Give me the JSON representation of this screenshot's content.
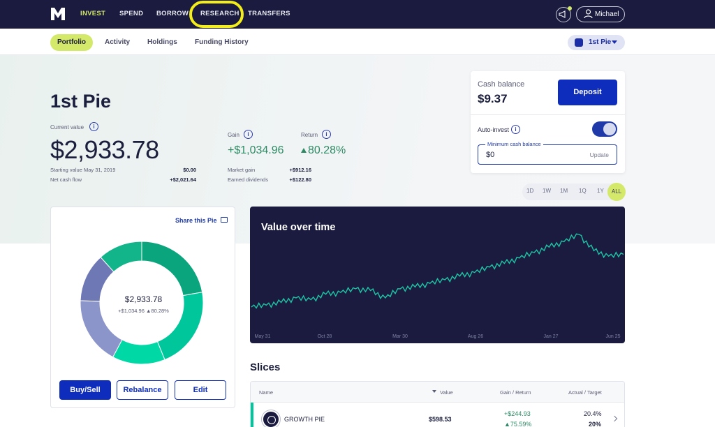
{
  "nav": {
    "logo": "M",
    "items": [
      {
        "label": "INVEST",
        "active": true
      },
      {
        "label": "SPEND"
      },
      {
        "label": "BORROW"
      },
      {
        "label": "RESEARCH",
        "highlighted": true
      },
      {
        "label": "TRANSFERS"
      }
    ],
    "user": "Michael"
  },
  "subnav": {
    "tabs": [
      "Portfolio",
      "Activity",
      "Holdings",
      "Funding History"
    ],
    "pie_selector": "1st Pie"
  },
  "pie": {
    "name": "1st Pie",
    "current_value_label": "Current value",
    "current_value": "$2,933.78",
    "starting_value_label": "Starting value May 31, 2019",
    "starting_value": "$0.00",
    "net_cash_flow_label": "Net cash flow",
    "net_cash_flow": "+$2,021.64",
    "gain_label": "Gain",
    "gain": "+$1,034.96",
    "return_label": "Return",
    "return": "80.28%",
    "market_gain_label": "Market gain",
    "market_gain": "+$912.16",
    "earned_dividends_label": "Earned dividends",
    "earned_dividends": "+$122.80"
  },
  "cash": {
    "label": "Cash balance",
    "value": "$9.37",
    "deposit": "Deposit",
    "auto_invest_label": "Auto-invest",
    "auto_invest_on": true,
    "min_label": "Minimum cash balance",
    "min_value": "$0",
    "update": "Update"
  },
  "ranges": [
    "1D",
    "1W",
    "1M",
    "1Q",
    "1Y",
    "ALL"
  ],
  "pie_card": {
    "share": "Share this Pie",
    "center_value": "$2,933.78",
    "center_sub": "+$1,034.96 ▲80.28%",
    "buttons": [
      "Buy/Sell",
      "Rebalance",
      "Edit"
    ],
    "segment_colors": [
      "#0aa57d",
      "#00c79b",
      "#00d9a5",
      "#8c95c9",
      "#6e78b5",
      "#12b489"
    ]
  },
  "chart": {
    "title": "Value over time",
    "x_labels": [
      "May 31",
      "Oct 28",
      "Mar 30",
      "Aug 26",
      "Jan 27",
      "Jun 25"
    ],
    "line_color": "#1ec5a4"
  },
  "chart_data": {
    "type": "line",
    "title": "Value over time",
    "x": [
      "May 31",
      "Oct 28",
      "Mar 30",
      "Aug 26",
      "Jan 27",
      "Jun 25"
    ],
    "series": [
      {
        "values": [
          0.2,
          0.22,
          0.25,
          0.3,
          0.28,
          0.34,
          0.36,
          0.4,
          0.38,
          0.3,
          0.4,
          0.42,
          0.46,
          0.5,
          0.54,
          0.58,
          0.64,
          0.68,
          0.74,
          0.8,
          0.86,
          0.92,
          1.0,
          0.82,
          0.76,
          0.78
        ]
      }
    ]
  },
  "slices": {
    "title": "Slices",
    "headers": [
      "Name",
      "Value",
      "Gain / Return",
      "Actual / Target"
    ],
    "rows": [
      {
        "name": "GROWTH PIE",
        "value": "$598.53",
        "gain": "+$244.93",
        "return": "▲75.59%",
        "actual": "20.4%",
        "target": "20%"
      }
    ]
  }
}
